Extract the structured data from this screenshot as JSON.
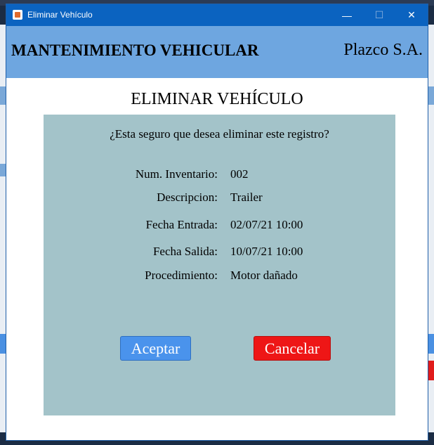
{
  "window": {
    "title": "Eliminar Vehículo",
    "controls": {
      "minimize": "—",
      "maximize": "☐",
      "close": "✕"
    }
  },
  "header": {
    "app_name": "MANTENIMIENTO VEHICULAR",
    "company": "Plazco S.A."
  },
  "page_title": "ELIMINAR VEHÍCULO",
  "dialog": {
    "question": "¿Esta seguro que desea eliminar este registro?",
    "fields": [
      {
        "label": "Num. Inventario:",
        "value": "002"
      },
      {
        "label": "Descripcion:",
        "value": "Trailer"
      },
      {
        "label": "Fecha Entrada:",
        "value": "02/07/21 10:00"
      },
      {
        "label": "Fecha Salida:",
        "value": "10/07/21 10:00"
      },
      {
        "label": "Procedimiento:",
        "value": "Motor dañado"
      }
    ],
    "accept_label": "Aceptar",
    "cancel_label": "Cancelar"
  },
  "colors": {
    "header": "#6ea6e0",
    "panel": "#a3c3c9",
    "accept": "#4a93ec",
    "cancel": "#ee1616"
  }
}
